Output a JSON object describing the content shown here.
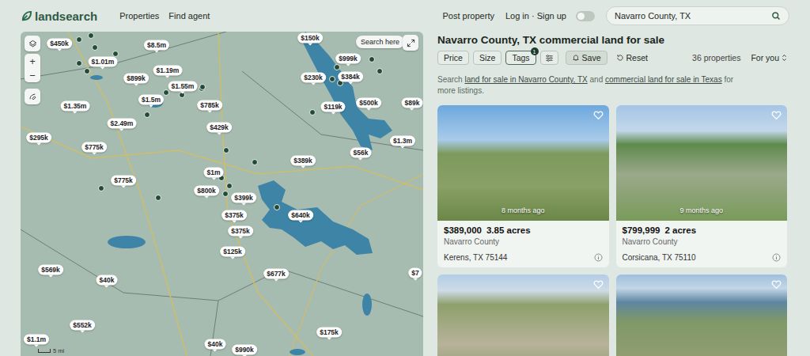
{
  "header": {
    "logo": "landsearch",
    "nav": [
      "Properties",
      "Find agent"
    ],
    "post": "Post property",
    "login": "Log in · Sign up",
    "dark_mode": false,
    "search": {
      "value": "Navarro County, TX"
    }
  },
  "map": {
    "search_here": "Search here",
    "zoom_in": "+",
    "zoom_out": "−",
    "scale": "5 mi",
    "pins": [
      {
        "label": "$450k"
      },
      {
        "label": "$8.5m"
      },
      {
        "label": "$150k"
      },
      {
        "label": "$1.01m"
      },
      {
        "label": "$1.19m"
      },
      {
        "label": "$999k"
      },
      {
        "label": "$899k"
      },
      {
        "label": "$1.55m"
      },
      {
        "label": "$230k"
      },
      {
        "label": "$384k"
      },
      {
        "label": "$1.5m"
      },
      {
        "label": "$1.35m"
      },
      {
        "label": "$785k"
      },
      {
        "label": "$119k"
      },
      {
        "label": "$500k"
      },
      {
        "label": "$89k"
      },
      {
        "label": "$2.49m"
      },
      {
        "label": "$429k"
      },
      {
        "label": "$295k"
      },
      {
        "label": "$775k"
      },
      {
        "label": "$1.3m"
      },
      {
        "label": "$56k"
      },
      {
        "label": "$389k"
      },
      {
        "label": "$775k"
      },
      {
        "label": "$1m"
      },
      {
        "label": "$800k"
      },
      {
        "label": "$399k"
      },
      {
        "label": "$640k"
      },
      {
        "label": "$375k"
      },
      {
        "label": "$375k"
      },
      {
        "label": "$125k"
      },
      {
        "label": "$677k"
      },
      {
        "label": "$569k"
      },
      {
        "label": "$40k"
      },
      {
        "label": "$552k"
      },
      {
        "label": "$175k"
      },
      {
        "label": "$1.1m"
      },
      {
        "label": "$40k"
      },
      {
        "label": "$990k"
      },
      {
        "label": "$7"
      }
    ]
  },
  "listing": {
    "title": "Navarro County, TX commercial land for sale",
    "filters": [
      {
        "label": "Price",
        "active": false,
        "badge": ""
      },
      {
        "label": "Size",
        "active": false,
        "badge": ""
      },
      {
        "label": "Tags",
        "active": true,
        "badge": "1"
      }
    ],
    "save": "Save",
    "reset": "Reset",
    "count": "36 properties",
    "sort": "For you",
    "intro": [
      {
        "text": "Search ",
        "link": false
      },
      {
        "text": "land for sale in Navarro County, TX",
        "link": true
      },
      {
        "text": " and ",
        "link": false
      },
      {
        "text": "commercial land for sale in Texas",
        "link": true
      },
      {
        "text": " for more listings.",
        "link": false
      }
    ],
    "cards": [
      {
        "price": "$389,000",
        "acres": "3.85 acres",
        "county": "Navarro County",
        "location": "Kerens, TX 75144",
        "age": "8 months ago",
        "saved": false,
        "photo": "a"
      },
      {
        "price": "$799,999",
        "acres": "2 acres",
        "county": "Navarro County",
        "location": "Corsicana, TX 75110",
        "age": "9 months ago",
        "saved": false,
        "photo": "b"
      },
      {
        "price": "",
        "acres": "",
        "county": "",
        "location": "",
        "age": "",
        "saved": false,
        "photo": "c"
      },
      {
        "price": "",
        "acres": "",
        "county": "",
        "location": "",
        "age": "",
        "saved": false,
        "photo": "d"
      }
    ]
  }
}
